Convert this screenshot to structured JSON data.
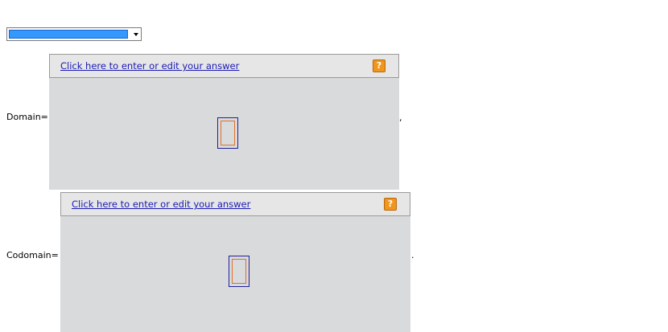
{
  "dropdown": {
    "selected_value": "",
    "highlight_color": "#3399ff"
  },
  "domain": {
    "label": "Domain=",
    "trailing_mark": ",",
    "panel": {
      "link_text": "Click here to enter or edit your answer",
      "help_glyph": "?",
      "help_icon": "question-mark-icon"
    }
  },
  "codomain": {
    "label": "Codomain=",
    "trailing_mark": ".",
    "panel": {
      "link_text": "Click here to enter or edit your answer",
      "help_glyph": "?",
      "help_icon": "question-mark-icon"
    }
  },
  "colors": {
    "link": "#1a1ab5",
    "panel_bg": "#d8dadc",
    "header_bg": "#e6e6e6",
    "help_bg": "#f0961e",
    "input_border": "#20209a",
    "input_inner_border": "#e0702a"
  }
}
